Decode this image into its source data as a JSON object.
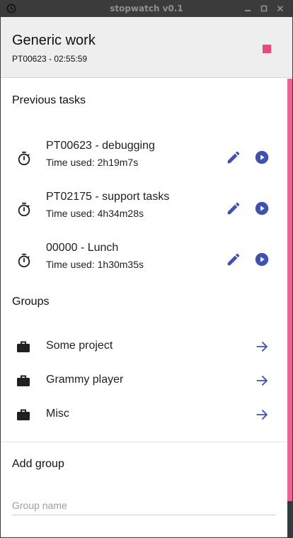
{
  "window": {
    "title": "stopwatch v0.1"
  },
  "current": {
    "title": "Generic work",
    "subtitle": "PT00623 - 02:55:59"
  },
  "previous": {
    "heading": "Previous tasks",
    "items": [
      {
        "name": "PT00623 - debugging",
        "time": "Time used: 2h19m7s"
      },
      {
        "name": "PT02175 - support tasks",
        "time": "Time used: 4h34m28s"
      },
      {
        "name": "00000 - Lunch",
        "time": "Time used: 1h30m35s"
      }
    ]
  },
  "groups": {
    "heading": "Groups",
    "items": [
      {
        "name": "Some project"
      },
      {
        "name": "Grammy player"
      },
      {
        "name": "Misc"
      }
    ]
  },
  "add_group": {
    "heading": "Add group",
    "placeholder": "Group name",
    "value": ""
  },
  "colors": {
    "accent": "#3f51b5",
    "stop": "#f0467f",
    "scrollbar": "#f06292",
    "header_bg": "#eeeeee"
  },
  "icons": {
    "task": "timer-icon",
    "edit": "edit-pencil-icon",
    "play": "play-circle-icon",
    "group": "briefcase-icon",
    "open": "arrow-right-icon",
    "stop": "stop-icon"
  }
}
